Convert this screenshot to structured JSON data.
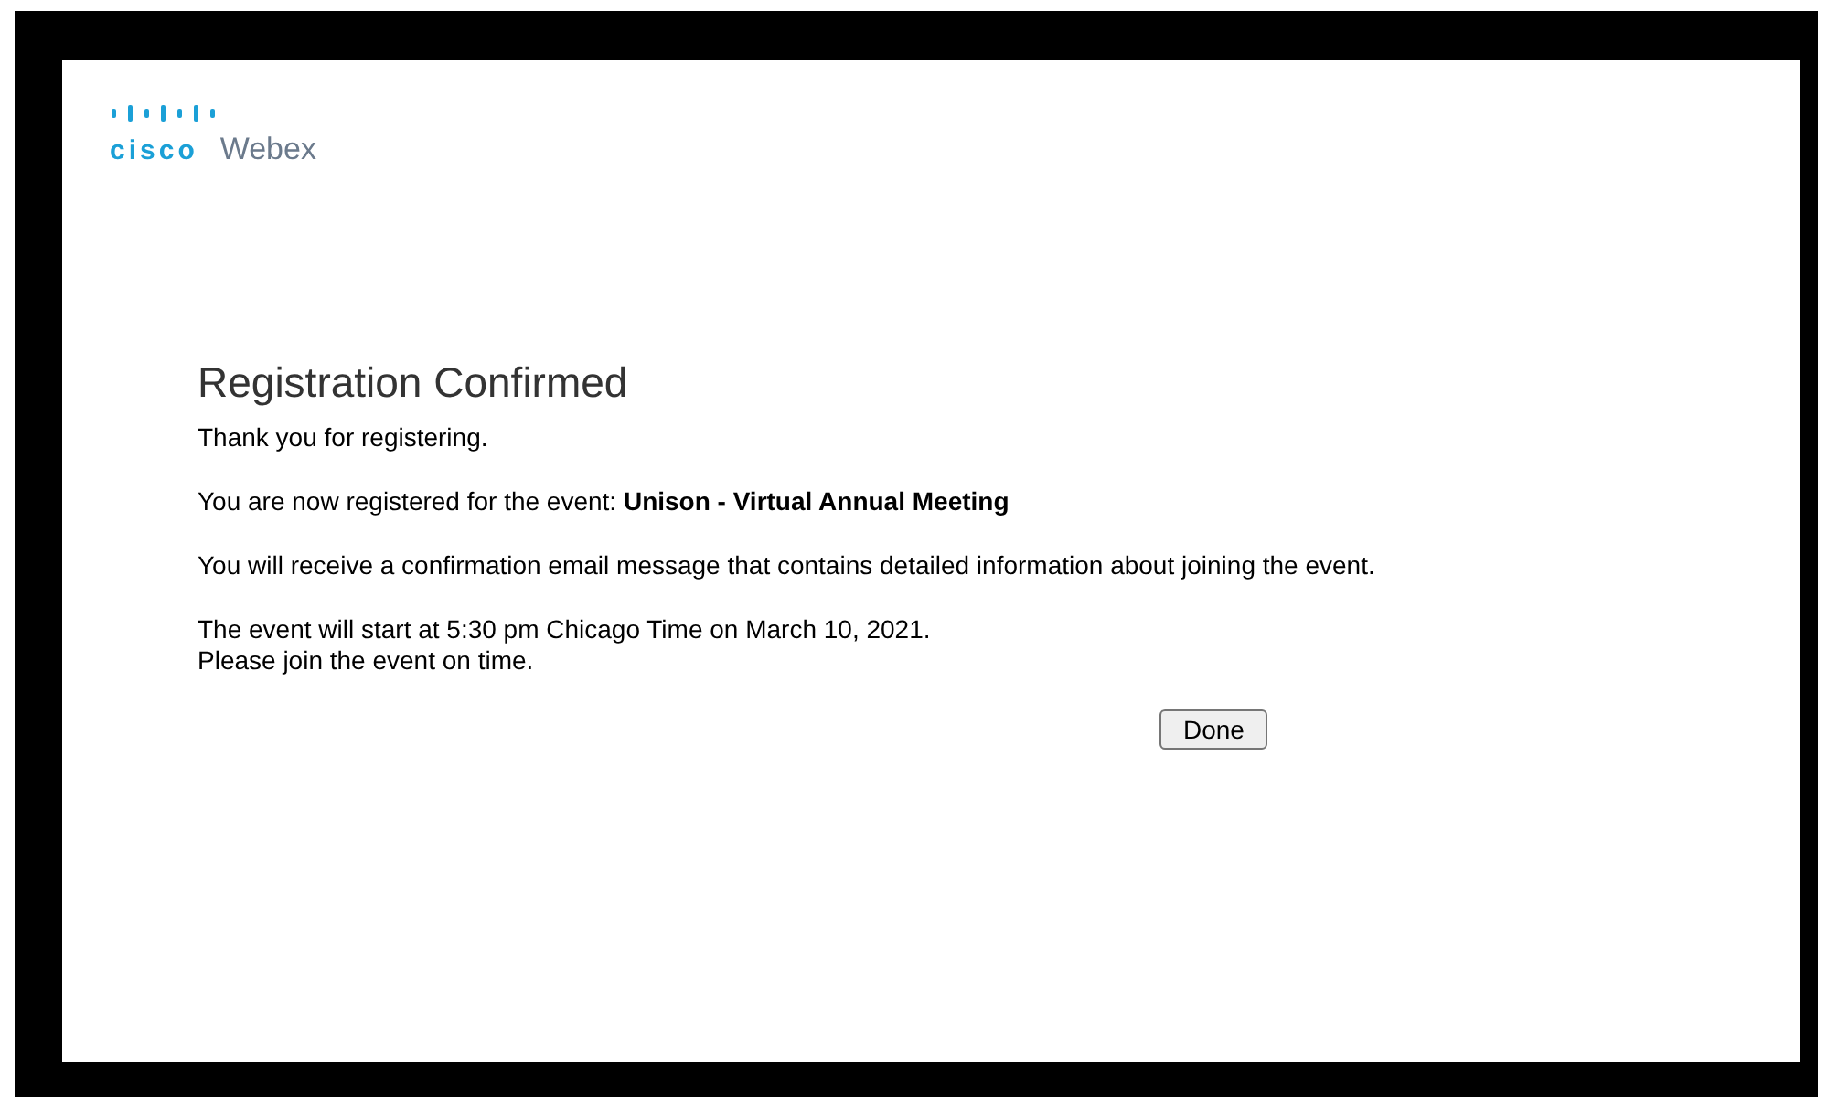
{
  "logo": {
    "brand": "cisco",
    "product": "Webex"
  },
  "heading": "Registration Confirmed",
  "paragraphs": [
    {
      "lines": [
        "Thank you for registering."
      ]
    },
    {
      "lines": [
        "You are now registered for the event: **Unison - Virtual Annual Meeting**"
      ]
    },
    {
      "lines": [
        "You will receive a confirmation email message that contains detailed information about joining the event."
      ]
    },
    {
      "lines": [
        "The event will start at 5:30 pm Chicago Time on March 10, 2021.",
        "Please join the event on time."
      ]
    }
  ],
  "button": "Done"
}
